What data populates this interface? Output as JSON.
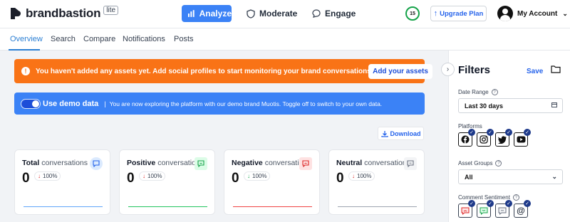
{
  "brand": {
    "name": "brandbastion",
    "tier": "lite"
  },
  "topnav": {
    "analyze": "Analyze",
    "moderate": "Moderate",
    "engage": "Engage",
    "credits": "15",
    "upgrade": "Upgrade Plan",
    "account": "My Account"
  },
  "tabs": [
    "Overview",
    "Search",
    "Compare",
    "Notifications",
    "Posts"
  ],
  "alert": {
    "message": "You haven't added any assets yet. Add social profiles to start monitoring your brand conversations.",
    "button": "Add your assets"
  },
  "demo": {
    "label": "Use demo data",
    "separator": "|",
    "text": "You are now exploring the platform with our demo brand Muotis. Toggle off to switch to your own data."
  },
  "download": "Download",
  "cards": [
    {
      "title_bold": "Total",
      "title_rest": " conversations",
      "value": "0",
      "change": "100%",
      "direction": "down",
      "icon": "chat-icon",
      "line_color": "#60a5fa"
    },
    {
      "title_bold": "Positive",
      "title_rest": " conversations",
      "value": "0",
      "change": "100%",
      "direction": "down",
      "icon": "positive-chat-icon",
      "line_color": "#22c55e"
    },
    {
      "title_bold": "Negative",
      "title_rest": " conversations",
      "value": "0",
      "change": "100%",
      "direction": "up",
      "icon": "negative-chat-icon",
      "line_color": "#ef4444"
    },
    {
      "title_bold": "Neutral",
      "title_rest": " conversations",
      "value": "0",
      "change": "100%",
      "direction": "down",
      "icon": "neutral-chat-icon",
      "line_color": "#9ca3af"
    }
  ],
  "filters": {
    "title": "Filters",
    "save": "Save",
    "date_range_label": "Date Range",
    "date_range_value": "Last 30 days",
    "platforms_label": "Platforms",
    "platforms": [
      "facebook-icon",
      "instagram-icon",
      "twitter-icon",
      "youtube-icon"
    ],
    "asset_groups_label": "Asset Groups",
    "asset_groups_value": "All",
    "comment_sentiment_label": "Comment Sentiment",
    "sentiments": [
      "negative-comment-icon",
      "positive-comment-icon",
      "neutral-comment-icon",
      "mention-icon"
    ]
  },
  "colors": {
    "primary": "#3b82f6",
    "alert": "#f97316",
    "link": "#2563eb",
    "down": "#dc2626",
    "up": "#16a34a"
  }
}
